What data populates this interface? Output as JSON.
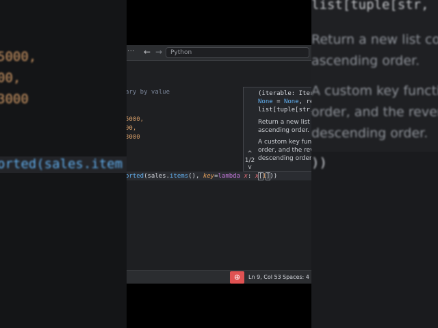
{
  "titlebar": {
    "menu_label": "···",
    "back_label": "←",
    "forward_label": "→",
    "search_placeholder": "Python",
    "extension_icon": "🔔"
  },
  "code": {
    "comment": "ary by value",
    "values": [
      "5000,",
      "00,",
      "3000"
    ],
    "line_fn": "orted",
    "line_open": "(sales.",
    "line_items": "items",
    "line_call": "(), ",
    "line_key": "key",
    "line_eq": "=",
    "line_lambda": "lambda ",
    "line_x": "x",
    "line_colon": ": ",
    "line_x2": "x",
    "line_idx_open": "[",
    "line_idx": "1",
    "line_idx_close": "]",
    "line_close": "))"
  },
  "signature": {
    "counter": "1/2",
    "up": "^",
    "down": "v",
    "line1a": "(",
    "line1b": "iterable: Itera",
    "line2a": "None",
    "line2b": " = ",
    "line2c": "None",
    "line2d": ", rev",
    "line3": "list[tuple[str,",
    "desc1a": "Return a new list co",
    "desc1b": "ascending order.",
    "desc2a": "A custom key functi",
    "desc2b": "order, and the rever",
    "desc2c": "descending order."
  },
  "status": {
    "position": "Ln 9, Col 53",
    "spaces": "Spaces: 4",
    "zoom_icon": "⊕"
  },
  "background_zoom": {
    "left_values": [
      "5000,",
      "00,",
      "3000"
    ],
    "left_line": "orted(sales.item",
    "right_sig": "list[tuple[str,",
    "right_desc1a": "Return a new list co",
    "right_desc1b": "ascending order.",
    "right_desc2a": "A custom key functio",
    "right_desc2b": "order, and the rever",
    "right_desc2c": "descending order.",
    "right_line_close": "))"
  },
  "colors": {
    "accent_red": "#e05252",
    "function_blue": "#61afef",
    "number_orange": "#d19a66"
  }
}
